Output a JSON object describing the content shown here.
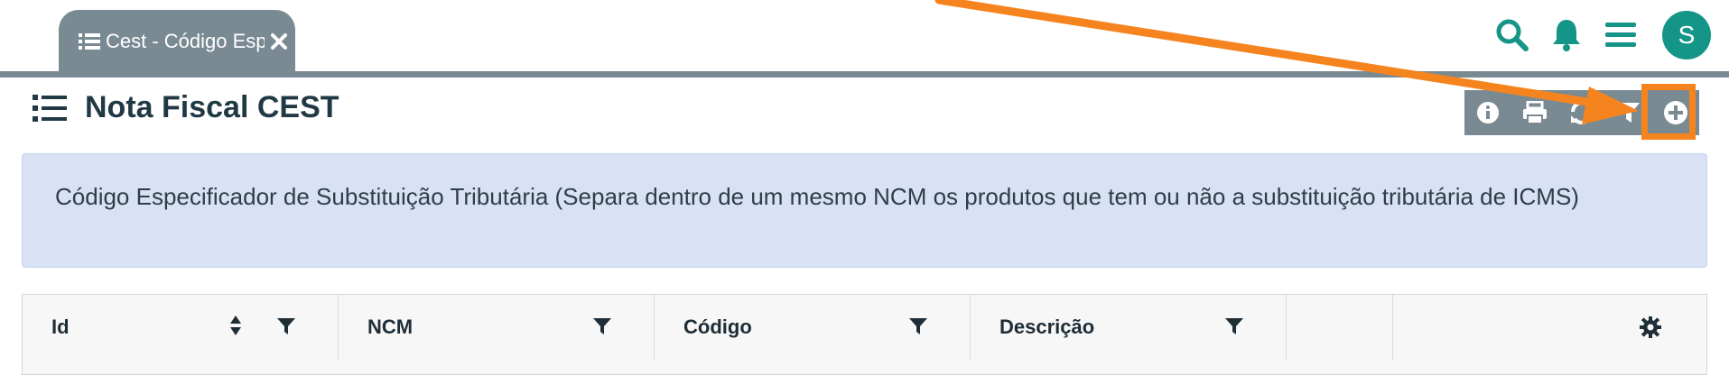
{
  "tab": {
    "label": "Cest - Código Especificador",
    "close_icon": "close-icon"
  },
  "header": {
    "avatar_letter": "S"
  },
  "page": {
    "title": "Nota Fiscal CEST"
  },
  "info": {
    "text": "Código Especificador de Substituição Tributária (Separa dentro de um mesmo NCM os produtos que tem ou não a substituição tributária de ICMS)"
  },
  "grid": {
    "columns": [
      {
        "label": "Id"
      },
      {
        "label": "NCM"
      },
      {
        "label": "Código"
      },
      {
        "label": "Descrição"
      }
    ]
  },
  "colors": {
    "accent": "#159488",
    "toolbar_bg": "#7a8a93",
    "highlight": "#f5841f",
    "info_bg": "#d8e2f4"
  }
}
